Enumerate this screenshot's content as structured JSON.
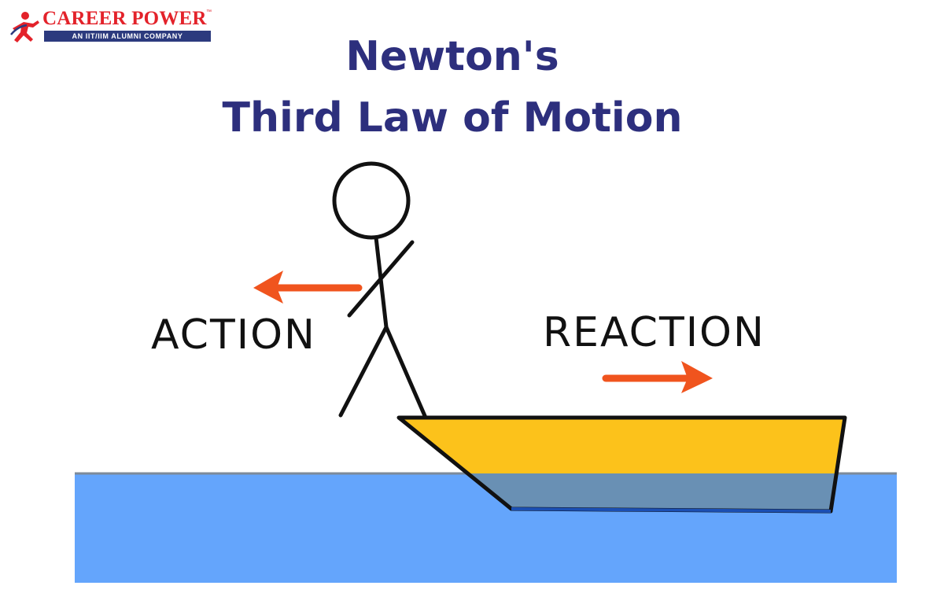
{
  "brand": {
    "name": "CAREER POWER",
    "tm": "™",
    "tagline": "AN IIT/IIM ALUMNI COMPANY",
    "color": "#e3222a",
    "tag_bg": "#2c3a7e"
  },
  "title": {
    "line1": "Newton's",
    "line2": "Third Law of Motion",
    "color": "#2d2f7d"
  },
  "diagram": {
    "action_label": "ACTION",
    "reaction_label": "REACTION",
    "arrow_color": "#f0541e",
    "boat_color": "#fcc21b",
    "water_color": "#64a5fc",
    "submerged_color": "#6990b4"
  }
}
